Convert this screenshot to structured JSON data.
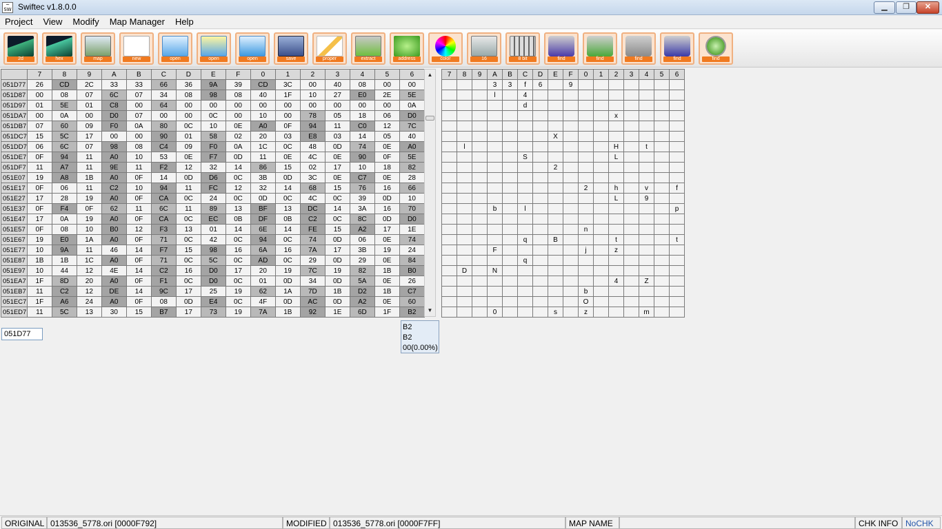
{
  "window": {
    "title": "Swiftec v1.8.0.0",
    "icon": "swiftec-logo-icon"
  },
  "menu": [
    "Project",
    "View",
    "Modify",
    "Map Manager",
    "Help"
  ],
  "toolbar": [
    {
      "label": "2d",
      "icon": "2d-graph-icon"
    },
    {
      "label": "hex",
      "icon": "hex-graph-icon"
    },
    {
      "label": "map",
      "icon": "map-picture-icon"
    },
    {
      "label": "new",
      "icon": "new-document-icon"
    },
    {
      "label": "open",
      "icon": "open-folder-icon"
    },
    {
      "label": "open",
      "icon": "open-flash-icon"
    },
    {
      "label": "open",
      "icon": "open-arrow-icon"
    },
    {
      "label": "save",
      "icon": "floppy-disk-icon"
    },
    {
      "label": "proper",
      "icon": "properties-pencil-icon"
    },
    {
      "label": "extract",
      "icon": "extract-icon"
    },
    {
      "label": "address",
      "icon": "shuffle-address-icon"
    },
    {
      "label": "color",
      "icon": "color-wheel-icon"
    },
    {
      "label": "16",
      "icon": "calculator-icon"
    },
    {
      "label": "8 bit",
      "icon": "sliders-icon"
    },
    {
      "label": "find",
      "icon": "find-back-double-icon"
    },
    {
      "label": "find",
      "icon": "find-plus-icon"
    },
    {
      "label": "find",
      "icon": "find-minus-icon"
    },
    {
      "label": "find",
      "icon": "find-forward-double-icon"
    },
    {
      "label": "find",
      "icon": "find-refresh-icon"
    }
  ],
  "hex_headers": [
    "7",
    "8",
    "9",
    "A",
    "B",
    "C",
    "D",
    "E",
    "F",
    "0",
    "1",
    "2",
    "3",
    "4",
    "5",
    "6"
  ],
  "hex_rows": [
    {
      "addr": "051D77",
      "cells": [
        "26",
        "CD",
        "2C",
        "33",
        "33",
        "66",
        "36",
        "9A",
        "39",
        "CD",
        "3C",
        "00",
        "40",
        "08",
        "00",
        "00"
      ]
    },
    {
      "addr": "051D87",
      "cells": [
        "00",
        "08",
        "07",
        "6C",
        "07",
        "34",
        "08",
        "98",
        "08",
        "40",
        "1F",
        "10",
        "27",
        "E0",
        "2E",
        "5E"
      ]
    },
    {
      "addr": "051D97",
      "cells": [
        "01",
        "5E",
        "01",
        "C8",
        "00",
        "64",
        "00",
        "00",
        "00",
        "00",
        "00",
        "00",
        "00",
        "00",
        "00",
        "0A"
      ]
    },
    {
      "addr": "051DA7",
      "cells": [
        "00",
        "0A",
        "00",
        "D0",
        "07",
        "00",
        "00",
        "0C",
        "00",
        "10",
        "00",
        "78",
        "05",
        "18",
        "06",
        "D0"
      ]
    },
    {
      "addr": "051DB7",
      "cells": [
        "07",
        "60",
        "09",
        "F0",
        "0A",
        "80",
        "0C",
        "10",
        "0E",
        "A0",
        "0F",
        "94",
        "11",
        "C0",
        "12",
        "7C"
      ]
    },
    {
      "addr": "051DC7",
      "cells": [
        "15",
        "5C",
        "17",
        "00",
        "00",
        "90",
        "01",
        "58",
        "02",
        "20",
        "03",
        "E8",
        "03",
        "14",
        "05",
        "40"
      ]
    },
    {
      "addr": "051DD7",
      "cells": [
        "06",
        "6C",
        "07",
        "98",
        "08",
        "C4",
        "09",
        "F0",
        "0A",
        "1C",
        "0C",
        "48",
        "0D",
        "74",
        "0E",
        "A0"
      ]
    },
    {
      "addr": "051DE7",
      "cells": [
        "0F",
        "94",
        "11",
        "A0",
        "10",
        "53",
        "0E",
        "F7",
        "0D",
        "11",
        "0E",
        "4C",
        "0E",
        "90",
        "0F",
        "5E"
      ]
    },
    {
      "addr": "051DF7",
      "cells": [
        "11",
        "A7",
        "11",
        "9E",
        "11",
        "F2",
        "12",
        "32",
        "14",
        "86",
        "15",
        "02",
        "17",
        "10",
        "18",
        "82"
      ]
    },
    {
      "addr": "051E07",
      "cells": [
        "19",
        "A8",
        "1B",
        "A0",
        "0F",
        "14",
        "0D",
        "D6",
        "0C",
        "3B",
        "0D",
        "3C",
        "0E",
        "C7",
        "0E",
        "28"
      ]
    },
    {
      "addr": "051E17",
      "cells": [
        "0F",
        "06",
        "11",
        "C2",
        "10",
        "94",
        "11",
        "FC",
        "12",
        "32",
        "14",
        "68",
        "15",
        "76",
        "16",
        "66"
      ]
    },
    {
      "addr": "051E27",
      "cells": [
        "17",
        "28",
        "19",
        "A0",
        "0F",
        "CA",
        "0C",
        "24",
        "0C",
        "0D",
        "0C",
        "4C",
        "0C",
        "39",
        "0D",
        "10"
      ]
    },
    {
      "addr": "051E37",
      "cells": [
        "0F",
        "F4",
        "0F",
        "62",
        "11",
        "6C",
        "11",
        "89",
        "13",
        "BF",
        "13",
        "DC",
        "14",
        "3A",
        "16",
        "70"
      ]
    },
    {
      "addr": "051E47",
      "cells": [
        "17",
        "0A",
        "19",
        "A0",
        "0F",
        "CA",
        "0C",
        "EC",
        "0B",
        "DF",
        "0B",
        "C2",
        "0C",
        "8C",
        "0D",
        "D0"
      ]
    },
    {
      "addr": "051E57",
      "cells": [
        "0F",
        "08",
        "10",
        "B0",
        "12",
        "F3",
        "13",
        "01",
        "14",
        "6E",
        "14",
        "FE",
        "15",
        "A2",
        "17",
        "1E"
      ]
    },
    {
      "addr": "051E67",
      "cells": [
        "19",
        "E0",
        "1A",
        "A0",
        "0F",
        "71",
        "0C",
        "42",
        "0C",
        "94",
        "0C",
        "74",
        "0D",
        "06",
        "0E",
        "74"
      ]
    },
    {
      "addr": "051E77",
      "cells": [
        "10",
        "9A",
        "11",
        "46",
        "14",
        "F7",
        "15",
        "98",
        "16",
        "6A",
        "16",
        "7A",
        "17",
        "3B",
        "19",
        "24"
      ]
    },
    {
      "addr": "051E87",
      "cells": [
        "1B",
        "1B",
        "1C",
        "A0",
        "0F",
        "71",
        "0C",
        "5C",
        "0C",
        "AD",
        "0C",
        "29",
        "0D",
        "29",
        "0E",
        "84"
      ]
    },
    {
      "addr": "051E97",
      "cells": [
        "10",
        "44",
        "12",
        "4E",
        "14",
        "C2",
        "16",
        "D0",
        "17",
        "20",
        "19",
        "7C",
        "19",
        "82",
        "1B",
        "B0"
      ]
    },
    {
      "addr": "051EA7",
      "cells": [
        "1F",
        "8D",
        "20",
        "A0",
        "0F",
        "F1",
        "0C",
        "D0",
        "0C",
        "01",
        "0D",
        "34",
        "0D",
        "5A",
        "0E",
        "26"
      ]
    },
    {
      "addr": "051EB7",
      "cells": [
        "11",
        "C2",
        "12",
        "DE",
        "14",
        "9C",
        "17",
        "25",
        "19",
        "62",
        "1A",
        "7D",
        "1B",
        "D2",
        "1B",
        "C7"
      ]
    },
    {
      "addr": "051EC7",
      "cells": [
        "1F",
        "A6",
        "24",
        "A0",
        "0F",
        "08",
        "0D",
        "E4",
        "0C",
        "4F",
        "0D",
        "AC",
        "0D",
        "A2",
        "0E",
        "60"
      ]
    },
    {
      "addr": "051ED7",
      "cells": [
        "11",
        "5C",
        "13",
        "30",
        "15",
        "B7",
        "17",
        "73",
        "19",
        "7A",
        "1B",
        "92",
        "1E",
        "6D",
        "1F",
        "B2"
      ]
    }
  ],
  "ascii_headers": [
    "7",
    "8",
    "9",
    "A",
    "B",
    "C",
    "D",
    "E",
    "F",
    "0",
    "1",
    "2",
    "3",
    "4",
    "5",
    "6"
  ],
  "ascii_rows": [
    [
      "",
      "",
      "",
      "3",
      "3",
      "f",
      "6",
      "",
      "9",
      "",
      "",
      "",
      "",
      "",
      "",
      ""
    ],
    [
      "",
      "",
      "",
      "l",
      "",
      "4",
      "",
      "",
      "",
      "",
      "",
      "",
      "",
      "",
      "",
      ""
    ],
    [
      "",
      "",
      "",
      "",
      "",
      "d",
      "",
      "",
      "",
      "",
      "",
      "",
      "",
      "",
      "",
      ""
    ],
    [
      "",
      "",
      "",
      "",
      "",
      "",
      "",
      "",
      "",
      "",
      "",
      "x",
      "",
      "",
      "",
      ""
    ],
    [
      "",
      "",
      "",
      "",
      "",
      "",
      "",
      "",
      "",
      "",
      "",
      "",
      "",
      "",
      "",
      ""
    ],
    [
      "",
      "",
      "",
      "",
      "",
      "",
      "",
      "X",
      "",
      "",
      "",
      "",
      "",
      "",
      "",
      ""
    ],
    [
      "",
      "l",
      "",
      "",
      "",
      "",
      "",
      "",
      "",
      "",
      "",
      "H",
      "",
      "t",
      "",
      ""
    ],
    [
      "",
      "",
      "",
      "",
      "",
      "S",
      "",
      "",
      "",
      "",
      "",
      "L",
      "",
      "",
      "",
      ""
    ],
    [
      "",
      "",
      "",
      "",
      "",
      "",
      "",
      "2",
      "",
      "",
      "",
      "",
      "",
      "",
      "",
      ""
    ],
    [
      "",
      "",
      "",
      "",
      "",
      "",
      "",
      "",
      "",
      "",
      "",
      "",
      "",
      "",
      "",
      ""
    ],
    [
      "",
      "",
      "",
      "",
      "",
      "",
      "",
      "",
      "",
      "2",
      "",
      "h",
      "",
      "v",
      "",
      "f"
    ],
    [
      "",
      "",
      "",
      "",
      "",
      "",
      "",
      "",
      "",
      "",
      "",
      "L",
      "",
      "9",
      "",
      ""
    ],
    [
      "",
      "",
      "",
      "b",
      "",
      "l",
      "",
      "",
      "",
      "",
      "",
      "",
      "",
      "",
      "",
      "p"
    ],
    [
      "",
      "",
      "",
      "",
      "",
      "",
      "",
      "",
      "",
      "",
      "",
      "",
      "",
      "",
      "",
      ""
    ],
    [
      "",
      "",
      "",
      "",
      "",
      "",
      "",
      "",
      "",
      "n",
      "",
      "",
      "",
      "",
      "",
      ""
    ],
    [
      "",
      "",
      "",
      "",
      "",
      "q",
      "",
      "B",
      "",
      "",
      "",
      "t",
      "",
      "",
      "",
      "t"
    ],
    [
      "",
      "",
      "",
      "F",
      "",
      "",
      "",
      "",
      "",
      "j",
      "",
      "z",
      "",
      "",
      "",
      ""
    ],
    [
      "",
      "",
      "",
      "",
      "",
      "q",
      "",
      "",
      "",
      "",
      "",
      "",
      "",
      "",
      "",
      ""
    ],
    [
      "",
      "D",
      "",
      "N",
      "",
      "",
      "",
      "",
      "",
      "",
      "",
      "",
      "",
      "",
      "",
      ""
    ],
    [
      "",
      "",
      "",
      "",
      "",
      "",
      "",
      "",
      "",
      "",
      "",
      "4",
      "",
      "Z",
      "",
      ""
    ],
    [
      "",
      "",
      "",
      "",
      "",
      "",
      "",
      "",
      "",
      "b",
      "",
      "",
      "",
      "",
      "",
      ""
    ],
    [
      "",
      "",
      "",
      "",
      "",
      "",
      "",
      "",
      "",
      "O",
      "",
      "",
      "",
      "",
      "",
      ""
    ],
    [
      "",
      "",
      "",
      "0",
      "",
      "",
      "",
      "s",
      "",
      "z",
      "",
      "",
      "",
      "m",
      "",
      ""
    ]
  ],
  "address_input": "051D77",
  "tooltip": {
    "line1": "B2",
    "line2": "B2",
    "line3": "00(0.00%)"
  },
  "status": {
    "original_label": "ORIGINAL",
    "original_value": "013536_5778.ori [0000F792]",
    "modified_label": "MODIFIED",
    "modified_value": "013536_5778.ori [0000F7FF]",
    "map_label": "MAP NAME",
    "map_value": "",
    "chk_label": "CHK INFO",
    "chk_value": "NoCHK"
  }
}
